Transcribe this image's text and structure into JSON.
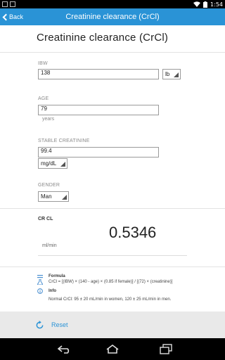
{
  "status_bar": {
    "time": "1:54",
    "icons": [
      "screenshot-notification-icon",
      "image-notification-icon",
      "wifi-icon",
      "battery-icon"
    ]
  },
  "action_bar": {
    "back_label": "Back",
    "title": "Creatinine clearance (CrCl)",
    "color": "#2a93d6"
  },
  "page": {
    "title": "Creatinine clearance (CrCl)"
  },
  "fields": {
    "ibw": {
      "label": "IBW",
      "value": "138",
      "unit": "lb"
    },
    "age": {
      "label": "AGE",
      "value": "79",
      "hint": "years"
    },
    "creatinine": {
      "label": "STABLE CREATININE",
      "value": "99.4",
      "unit": "mg/dL"
    },
    "gender": {
      "label": "GENDER",
      "value": "Man"
    }
  },
  "result": {
    "label": "CR CL",
    "value": "0.5346",
    "unit": "ml/min"
  },
  "info": {
    "formula_title": "Formula",
    "formula_text": "CrCl = [(IBW) × (140 - age) × (0.85 if female)] / [(72) × (creatinine)]",
    "info_title": "Info",
    "info_text": "Normal CrCl: 95 ± 20 mL/min in women, 120 ± 25 mL/min in men."
  },
  "reset": {
    "label": "Reset",
    "accent": "#2a93d6"
  },
  "nav": {
    "icons": [
      "back-nav-icon",
      "home-nav-icon",
      "recent-apps-icon"
    ]
  }
}
